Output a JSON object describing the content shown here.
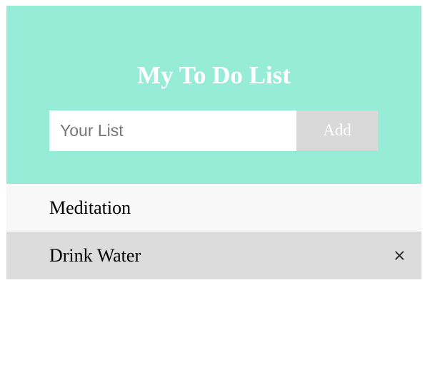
{
  "header": {
    "title": "My To Do List"
  },
  "form": {
    "placeholder": "Your List",
    "value": "",
    "add_label": "Add"
  },
  "items": [
    {
      "label": "Meditation",
      "close": ""
    },
    {
      "label": "Drink Water",
      "close": "×"
    }
  ],
  "colors": {
    "header_bg": "#96ecd7",
    "button_bg": "#d9d9d9",
    "item_odd": "#f8f8f8",
    "item_even": "#dcdcdc"
  }
}
